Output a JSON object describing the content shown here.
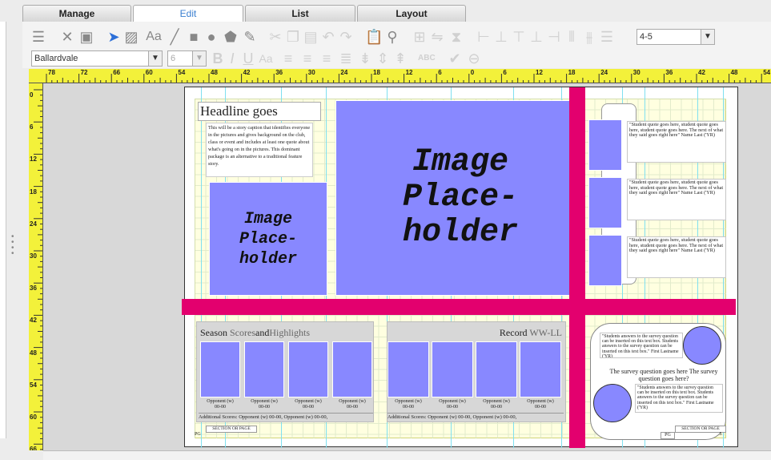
{
  "tabs": [
    {
      "label": "Manage"
    },
    {
      "label": "Edit"
    },
    {
      "label": "List"
    },
    {
      "label": "Layout"
    }
  ],
  "toolbar": {
    "font_value": "Ballardvale",
    "size_value": "6",
    "view_value": "4-5"
  },
  "ruler_h": [
    "78",
    "72",
    "66",
    "60",
    "54",
    "48",
    "42",
    "36",
    "30",
    "24",
    "18",
    "12",
    "6",
    "0",
    "6",
    "12",
    "18",
    "24",
    "30",
    "36",
    "42",
    "48",
    "54"
  ],
  "ruler_v": [
    "0",
    "6",
    "12",
    "18",
    "24",
    "30",
    "36",
    "42",
    "48",
    "54",
    "60",
    "66"
  ],
  "page": {
    "headline": "Headline goes",
    "story": "This will be a story caption that identifies everyone in the pictures and gives background on the club, class or event and includes at least one quote about what's going on in the pictures. This dominant package is an alternative to a traditional feature story.",
    "small_placeholder": "Image\nPlace-\nholder",
    "big_placeholder": "Image\nPlace-\nholder",
    "quotes": [
      "\"Student quote goes here, student quote goes here, student quote goes here. The next of what they said goes right here\" Name Last ('YR)",
      "\"Student quote goes here, student quote goes here, student quote goes here. The next of what they said goes right here\" Name Last ('YR)",
      "\"Student quote goes here, student quote goes here, student quote goes here. The next of what they said goes right here\" Name Last ('YR)"
    ],
    "season_head": {
      "a": "Season ",
      "b": "Scores",
      "c": "and",
      "d": "Highlights"
    },
    "record_head": {
      "a": "Record ",
      "b": "WW-LL"
    },
    "opponent": "Opponent (w)",
    "score": "00-00",
    "additional": "Additional Scores:  Opponent (w) 00-00,  Opponent (w) 00-00,",
    "survey_q": "The survey question goes here The survey question goes here?",
    "survey_a1": "\"Students answers to the survey question can be inserted on this text box. Students answers to the survey question can be inserted on this text box.\" First Lastname ('YR)",
    "survey_a2": "\"Students answers to the survey question can be inserted on this text box. Students answers to the survey question can be inserted on this text box.\" First Lastname ('YR)",
    "section_left": "SECTION OR PAGE",
    "section_right": "SECTION OR PAGE",
    "pg_left": "PG",
    "pg_right": "PG",
    "page_num": "5"
  }
}
